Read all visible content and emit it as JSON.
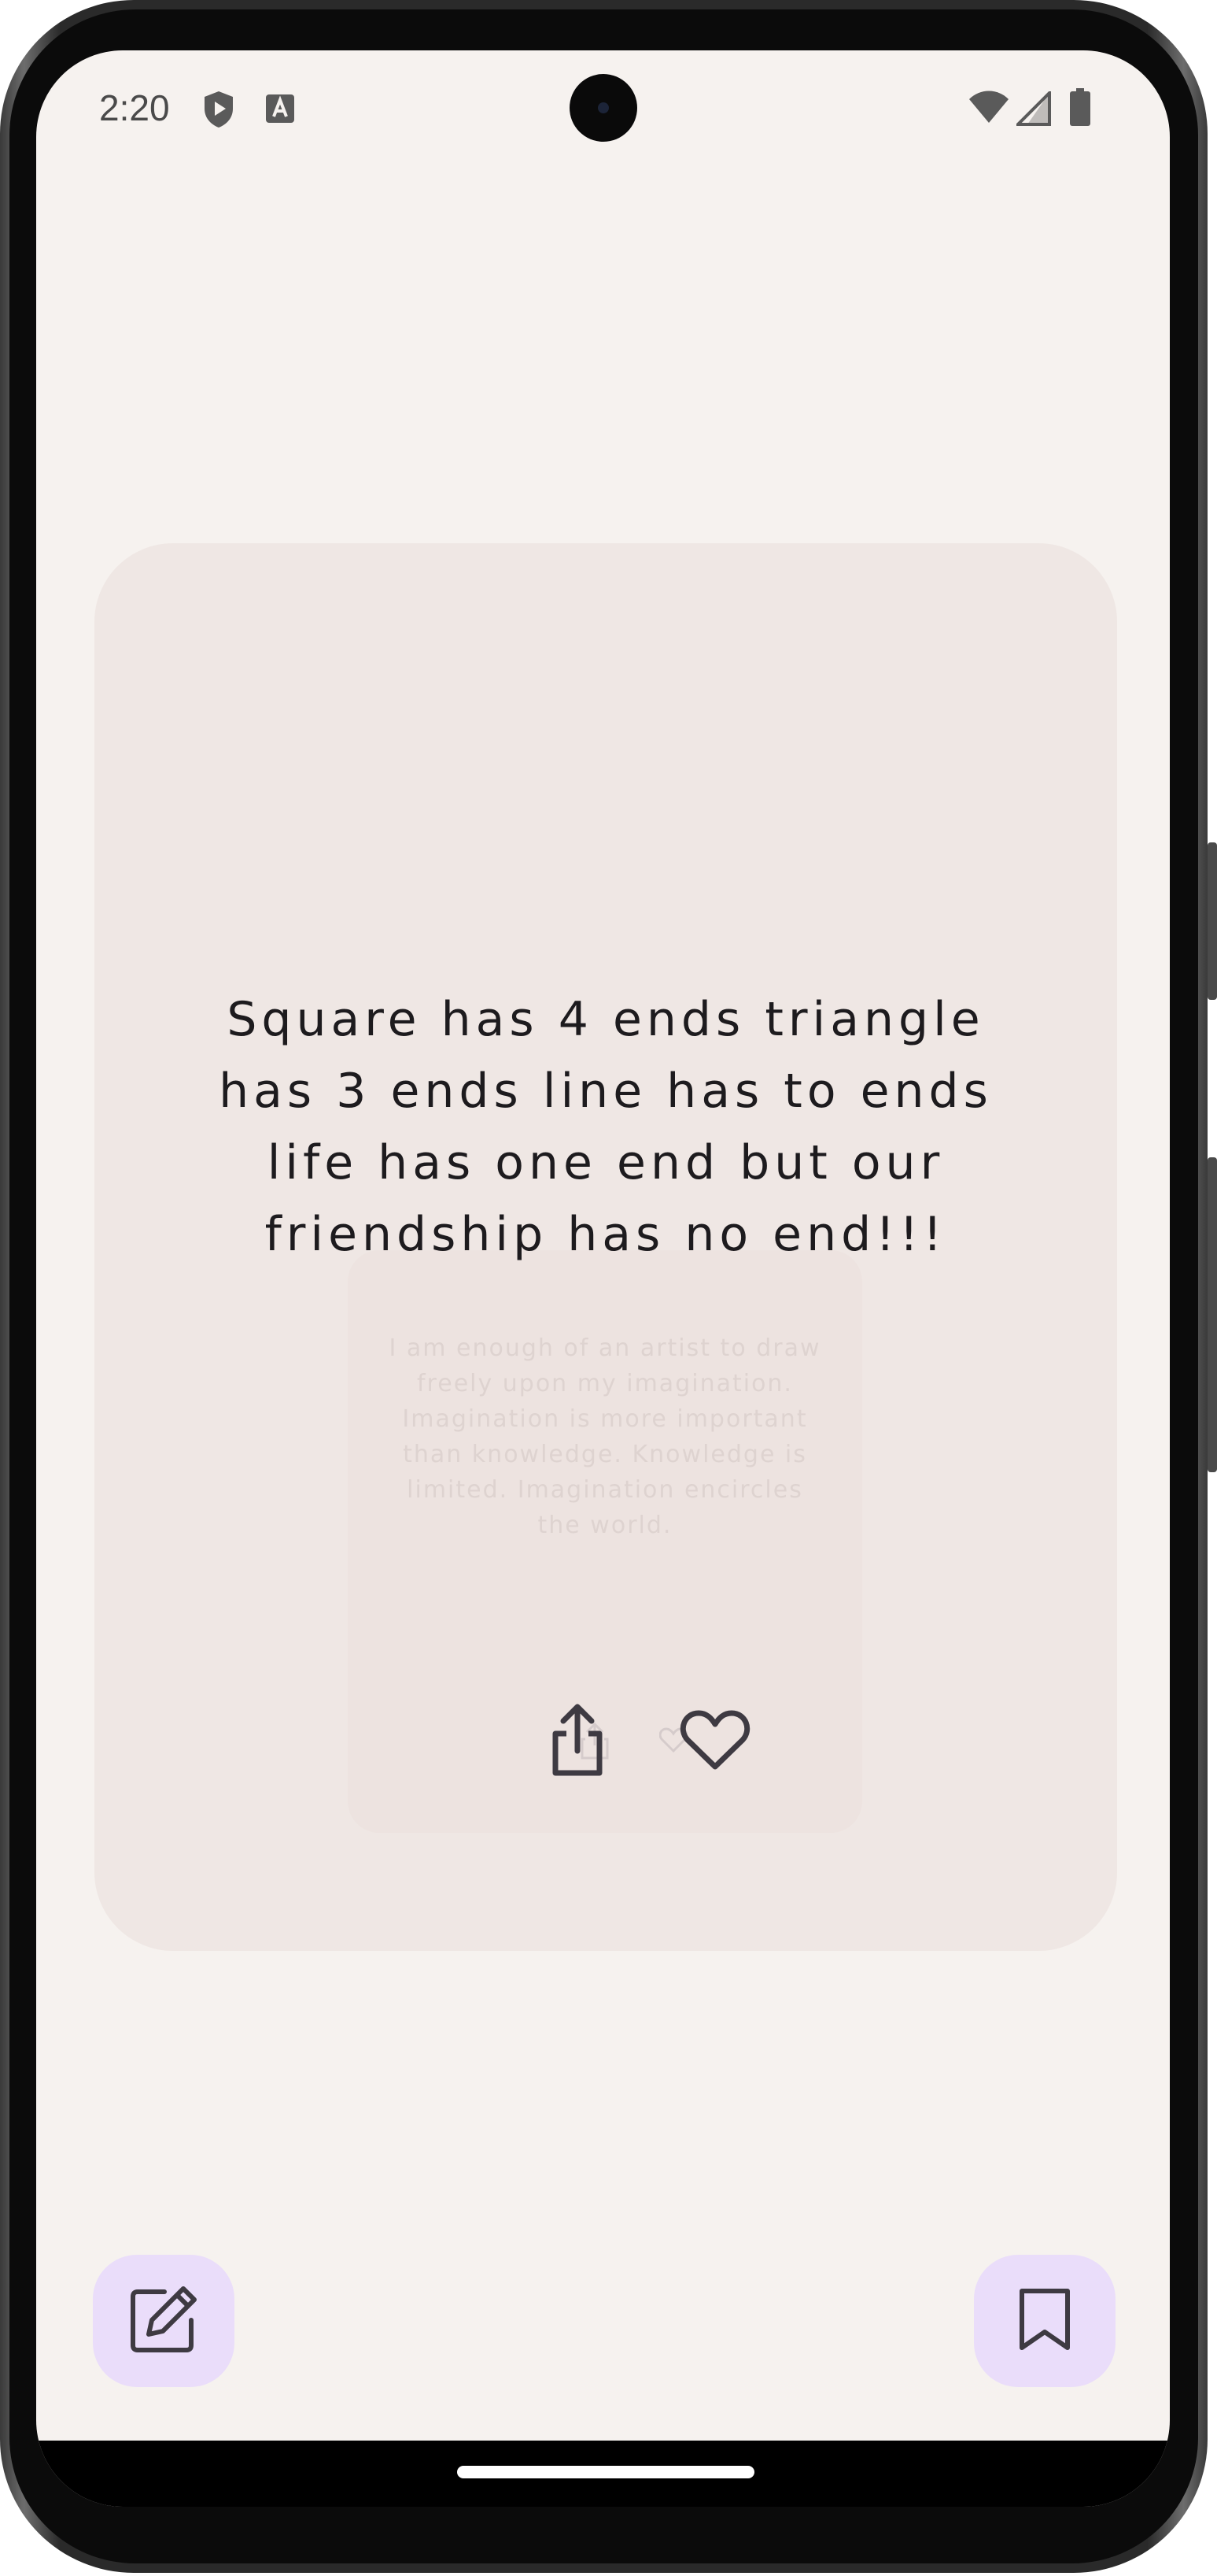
{
  "status_bar": {
    "time": "2:20",
    "icons": [
      "shield-play-icon",
      "font-a-icon",
      "wifi-icon",
      "signal-icon",
      "battery-icon"
    ]
  },
  "quote_card": {
    "text": "Square has 4 ends triangle has 3 ends line has to ends life has one end but our friendship has no end!!!",
    "background_text": "I am enough of an artist to draw freely upon my imagination. Imagination is more important than knowledge. Knowledge is limited. Imagination encircles the world.",
    "actions": [
      "share-icon",
      "heart-icon"
    ]
  },
  "fabs": {
    "left": "edit-icon",
    "right": "bookmark-icon"
  },
  "colors": {
    "screen_bg": "#f6f2ef",
    "card_bg": "#efe7e4",
    "fab_bg": "#eaddfa",
    "icon": "#3e3a42"
  }
}
